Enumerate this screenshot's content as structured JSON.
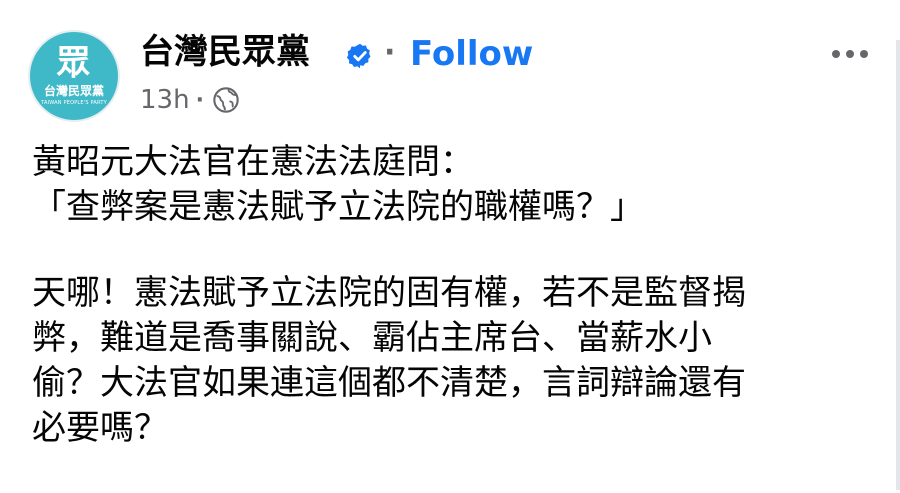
{
  "post": {
    "avatar": {
      "logo_text": "眾",
      "name_text": "台灣民眾黨",
      "sub_text": "TAIWAN PEOPLE'S PARTY"
    },
    "page_name": "台灣民眾黨",
    "separator": "·",
    "follow_label": "Follow",
    "timestamp": "13h",
    "meta_separator": "·",
    "paragraph1": [
      "黃昭元大法官在憲法法庭問：",
      "「查弊案是憲法賦予立法院的職權嗎？」"
    ],
    "paragraph2": [
      "天哪！憲法賦予立法院的固有權，若不是監督揭",
      "弊，難道是喬事關說、霸佔主席台、當薪水小",
      "偷？大法官如果連這個都不清楚，言詞辯論還有",
      "必要嗎？"
    ]
  },
  "icons": {
    "verified": "verified-badge-icon",
    "audience": "globe-icon",
    "more": "more-options-icon"
  },
  "colors": {
    "brand_teal": "#3fb8c8",
    "link_blue": "#1877f2",
    "secondary_text": "#65676b",
    "primary_text": "#050505"
  }
}
